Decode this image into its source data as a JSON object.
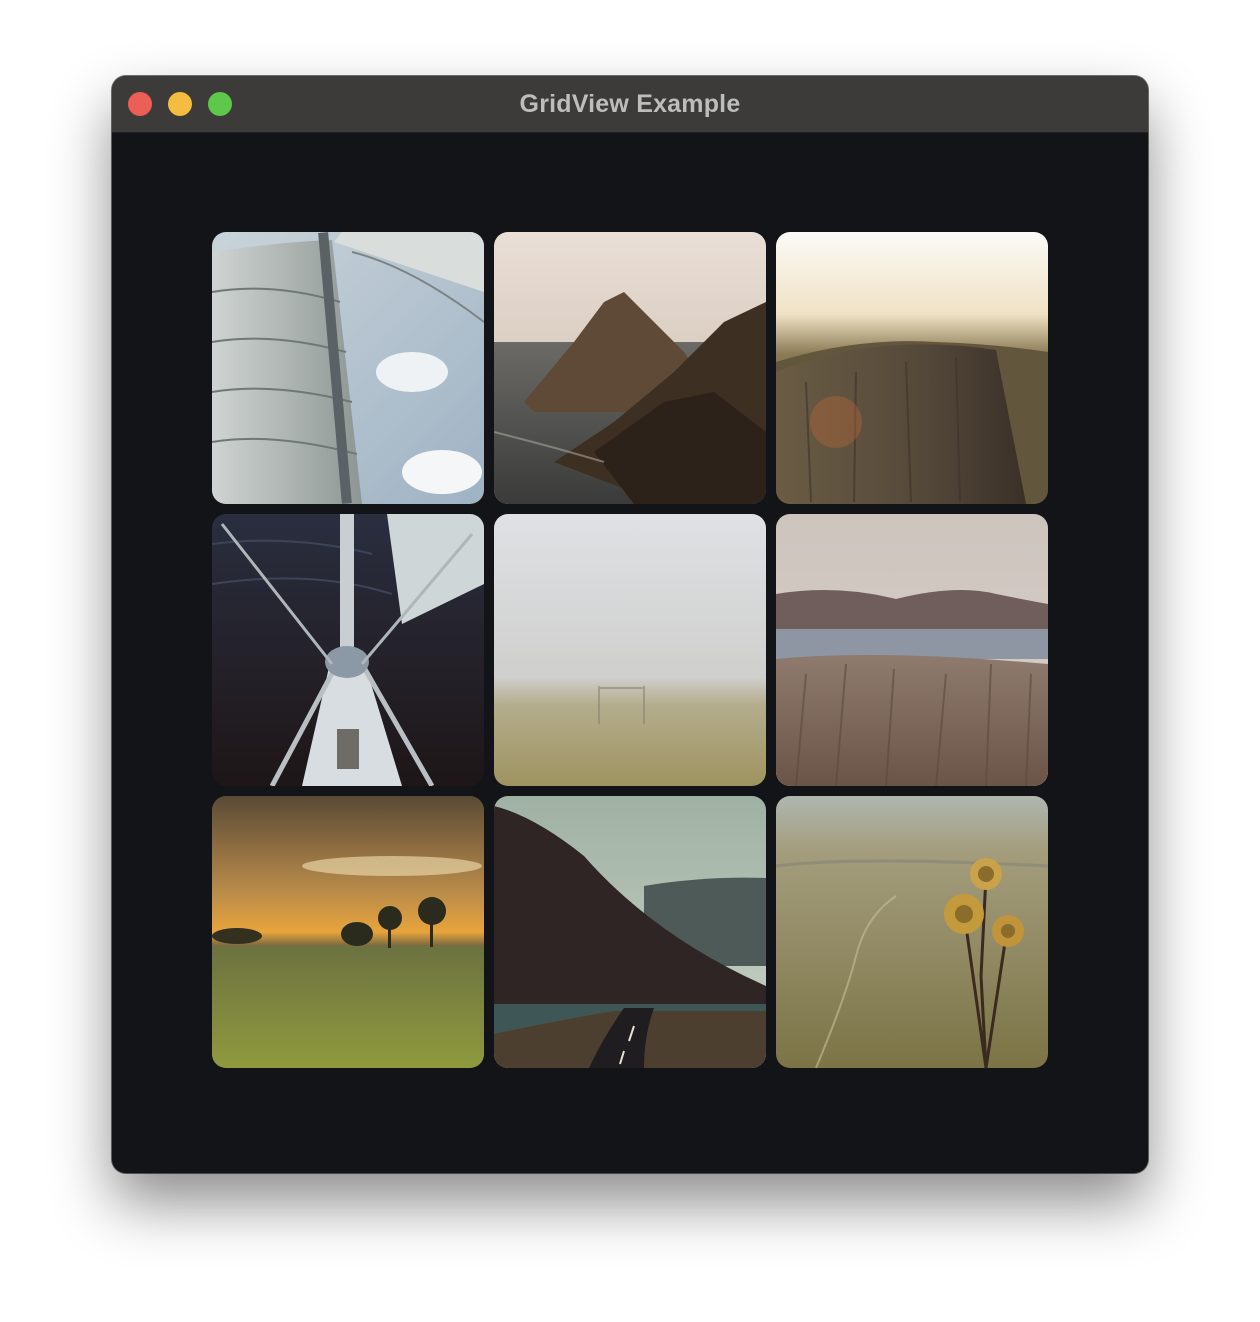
{
  "window": {
    "title": "GridView Example"
  },
  "grid": {
    "columns": 3,
    "items": [
      {
        "icon": "sail-photo"
      },
      {
        "icon": "coastal-cliff-photo"
      },
      {
        "icon": "tree-stump-photo"
      },
      {
        "icon": "boat-bow-photo"
      },
      {
        "icon": "foggy-field-photo"
      },
      {
        "icon": "lake-hills-photo"
      },
      {
        "icon": "sunset-meadow-photo"
      },
      {
        "icon": "mountain-road-photo"
      },
      {
        "icon": "thistle-valley-photo"
      }
    ]
  },
  "colors": {
    "window_background": "#131418",
    "titlebar": "#3c3b3a",
    "title_text": "#bdbdbd",
    "close": "#ec5f57",
    "minimize": "#f4bd3f",
    "maximize": "#5ec84b"
  }
}
